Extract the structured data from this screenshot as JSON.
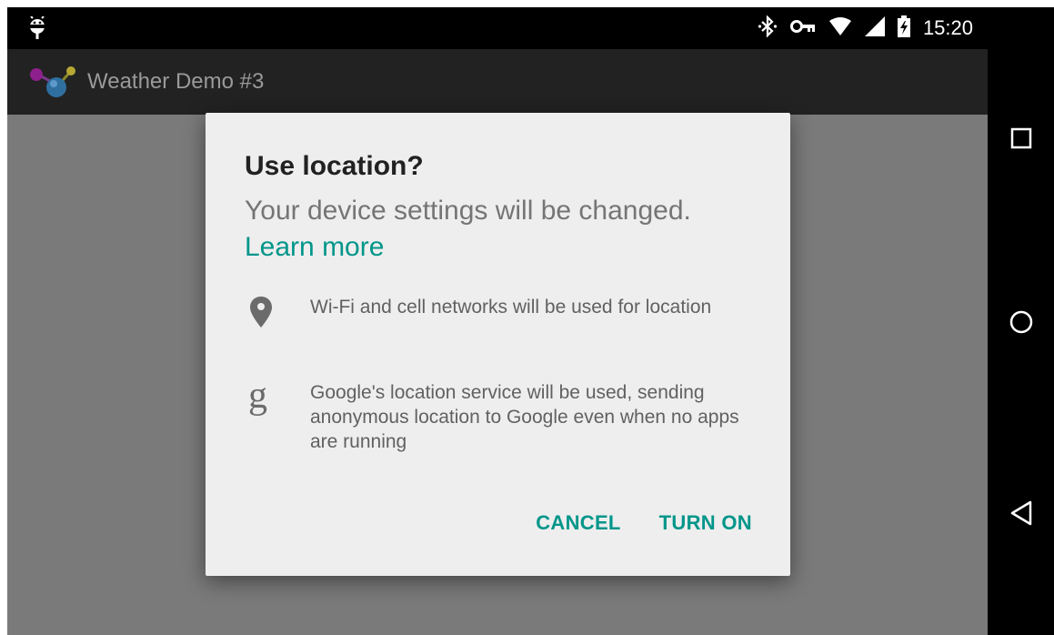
{
  "status_bar": {
    "time": "15:20",
    "icons": [
      "android-debug-icon",
      "bluetooth-icon",
      "vpn-key-icon",
      "wifi-icon",
      "cell-signal-icon",
      "battery-charging-icon"
    ]
  },
  "app_bar": {
    "title": "Weather Demo #3",
    "logo_icon": "app-logo-icon"
  },
  "dialog": {
    "title": "Use location?",
    "message": "Your device settings will be changed.",
    "link": "Learn more",
    "items": [
      {
        "icon": "location-pin-icon",
        "text": "Wi-Fi and cell networks will be used for location"
      },
      {
        "icon": "google-g-icon",
        "text": "Google's location service will be used, sending anonymous location to Google even when no apps are running"
      }
    ],
    "buttons": {
      "cancel": "CANCEL",
      "confirm": "TURN ON"
    }
  },
  "nav_bar": {
    "buttons": [
      "recents-icon",
      "home-icon",
      "back-icon"
    ]
  },
  "colors": {
    "accent": "#00968a",
    "app_bar": "#222222",
    "scrim": "#7a7a7a",
    "dialog_bg": "#eeeeee"
  }
}
